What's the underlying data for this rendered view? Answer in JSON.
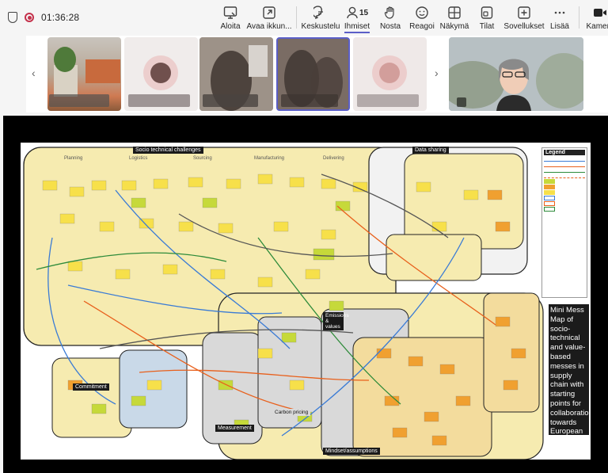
{
  "meeting": {
    "timer": "01:36:28"
  },
  "toolbar": {
    "items": [
      {
        "label": "Aloita",
        "icon": "whiteboard-start-icon"
      },
      {
        "label": "Avaa ikkun...",
        "icon": "open-window-icon"
      },
      {
        "label": "Keskustelu",
        "icon": "chat-icon"
      },
      {
        "label": "Ihmiset",
        "icon": "people-icon",
        "count": "15",
        "active": true
      },
      {
        "label": "Nosta",
        "icon": "raise-hand-icon"
      },
      {
        "label": "Reagoi",
        "icon": "react-icon"
      },
      {
        "label": "Näkymä",
        "icon": "view-icon"
      },
      {
        "label": "Tilat",
        "icon": "rooms-icon"
      },
      {
        "label": "Sovellukset",
        "icon": "apps-icon"
      },
      {
        "label": "Lisää",
        "icon": "more-icon"
      },
      {
        "label": "Kamera",
        "icon": "camera-icon"
      }
    ]
  },
  "board": {
    "labels": {
      "socio": "Socio technical challenges",
      "data_sharing": "Data sharing",
      "legend": "Legend",
      "emissions": "Emissions & values",
      "commitment": "Commitment",
      "carbon": "Carbon pricing",
      "measurement": "Measurement",
      "mindset": "Mindset/assumptions",
      "planning": "Planning",
      "logistics": "Logistics",
      "sourcing": "Sourcing",
      "manufacturing": "Manufacturing",
      "delivering": "Delivering"
    },
    "mini_mess_text": "Mini Mess Map of socio-technical and value-based messes in supply chain with starting points for collaboration towards European sustainability transition in logistics"
  },
  "colors": {
    "accent": "#5b5fc7",
    "record": "#c4314b",
    "yellow_zone": "#f6ebb0",
    "blue_zone": "#c9d9e8",
    "orange_node": "#f0a030",
    "green_node": "#c6d93a",
    "yellow_node": "#f7e04a"
  }
}
